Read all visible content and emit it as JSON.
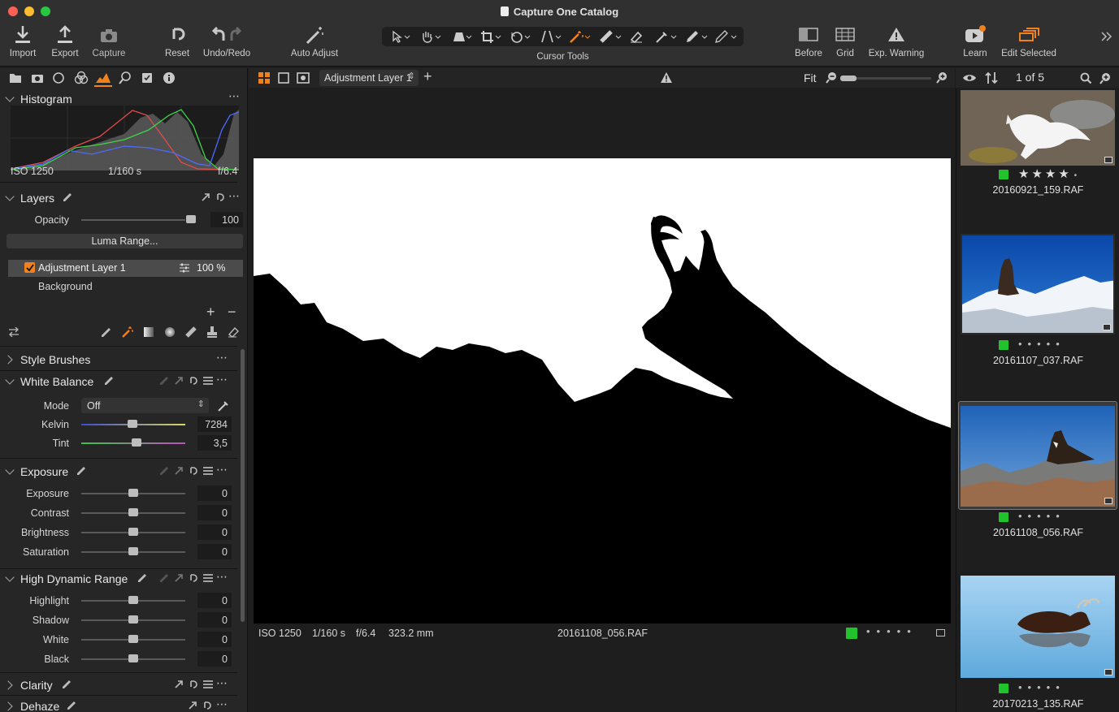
{
  "window": {
    "title": "Capture One Catalog"
  },
  "toolbar": {
    "import": "Import",
    "export": "Export",
    "capture": "Capture",
    "reset": "Reset",
    "undo_redo": "Undo/Redo",
    "auto_adjust": "Auto Adjust",
    "cursor_tools": "Cursor Tools",
    "before": "Before",
    "grid": "Grid",
    "exp_warning": "Exp. Warning",
    "learn": "Learn",
    "edit_selected": "Edit Selected"
  },
  "viewer_bar": {
    "layer_select": "Adjustment Layer 1",
    "fit": "Fit",
    "zoom_level": 0.05
  },
  "browser_bar": {
    "count": "1 of 5"
  },
  "histogram": {
    "title": "Histogram",
    "iso": "ISO 1250",
    "shutter": "1/160 s",
    "aperture": "f/6.4"
  },
  "layers": {
    "title": "Layers",
    "opacity_label": "Opacity",
    "opacity_value": "100",
    "luma_range": "Luma Range...",
    "items": [
      {
        "name": "Adjustment Layer 1",
        "opacity": "100 %",
        "checked": true
      },
      {
        "name": "Background"
      }
    ]
  },
  "style_brushes": {
    "title": "Style Brushes"
  },
  "white_balance": {
    "title": "White Balance",
    "mode_label": "Mode",
    "mode_value": "Off",
    "kelvin_label": "Kelvin",
    "kelvin_value": "7284",
    "tint_label": "Tint",
    "tint_value": "3,5"
  },
  "exposure": {
    "title": "Exposure",
    "rows": [
      {
        "label": "Exposure",
        "value": "0"
      },
      {
        "label": "Contrast",
        "value": "0"
      },
      {
        "label": "Brightness",
        "value": "0"
      },
      {
        "label": "Saturation",
        "value": "0"
      }
    ]
  },
  "hdr": {
    "title": "High Dynamic Range",
    "rows": [
      {
        "label": "Highlight",
        "value": "0"
      },
      {
        "label": "Shadow",
        "value": "0"
      },
      {
        "label": "White",
        "value": "0"
      },
      {
        "label": "Black",
        "value": "0"
      }
    ]
  },
  "clarity": {
    "title": "Clarity"
  },
  "dehaze": {
    "title": "Dehaze"
  },
  "viewer_status": {
    "iso": "ISO 1250",
    "shutter": "1/160 s",
    "aperture": "f/6.4",
    "focal": "323.2 mm",
    "filename": "20161108_056.RAF"
  },
  "thumbnails": [
    {
      "name": "20160921_159.RAF",
      "stars": 4
    },
    {
      "name": "20161107_037.RAF",
      "stars": 0
    },
    {
      "name": "20161108_056.RAF",
      "stars": 0,
      "selected": true
    },
    {
      "name": "20170213_135.RAF",
      "stars": 0
    }
  ],
  "colors": {
    "accent": "#f0821e",
    "green_tag": "#22c22c",
    "panel": "#262626"
  }
}
